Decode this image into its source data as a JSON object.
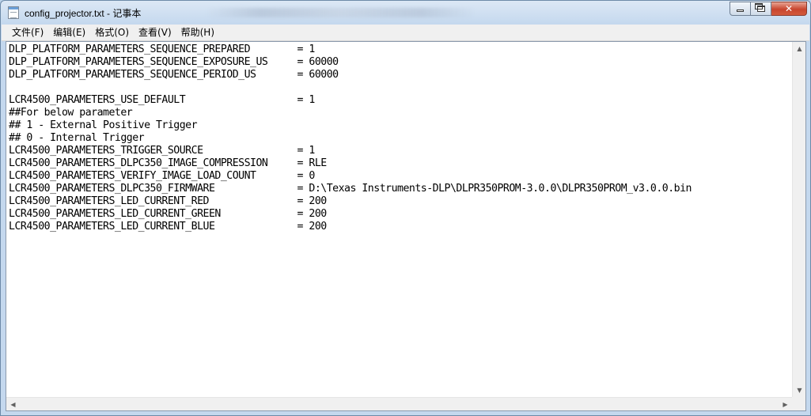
{
  "window": {
    "title": "config_projector.txt - 记事本"
  },
  "menu": {
    "items": [
      {
        "label": "文件(F)"
      },
      {
        "label": "编辑(E)"
      },
      {
        "label": "格式(O)"
      },
      {
        "label": "查看(V)"
      },
      {
        "label": "帮助(H)"
      }
    ]
  },
  "document": {
    "lines": [
      "DLP_PLATFORM_PARAMETERS_SEQUENCE_PREPARED        = 1",
      "DLP_PLATFORM_PARAMETERS_SEQUENCE_EXPOSURE_US     = 60000",
      "DLP_PLATFORM_PARAMETERS_SEQUENCE_PERIOD_US       = 60000",
      "",
      "LCR4500_PARAMETERS_USE_DEFAULT                   = 1",
      "##For below parameter",
      "## 1 - External Positive Trigger",
      "## 0 - Internal Trigger",
      "LCR4500_PARAMETERS_TRIGGER_SOURCE                = 1",
      "LCR4500_PARAMETERS_DLPC350_IMAGE_COMPRESSION     = RLE",
      "LCR4500_PARAMETERS_VERIFY_IMAGE_LOAD_COUNT       = 0",
      "LCR4500_PARAMETERS_DLPC350_FIRMWARE              = D:\\Texas Instruments-DLP\\DLPR350PROM-3.0.0\\DLPR350PROM_v3.0.0.bin",
      "LCR4500_PARAMETERS_LED_CURRENT_RED               = 200",
      "LCR4500_PARAMETERS_LED_CURRENT_GREEN             = 200",
      "LCR4500_PARAMETERS_LED_CURRENT_BLUE              = 200"
    ]
  },
  "icons": {
    "app": "notepad-icon",
    "minimize": "minimize-icon",
    "maximize": "maximize-icon",
    "close": "close-icon",
    "scroll_up": "arrow-up-icon",
    "scroll_down": "arrow-down-icon",
    "scroll_left": "arrow-left-icon",
    "scroll_right": "arrow-right-icon"
  },
  "colors": {
    "close_button": "#c8452e",
    "title_bar": "#c4d8ee"
  }
}
